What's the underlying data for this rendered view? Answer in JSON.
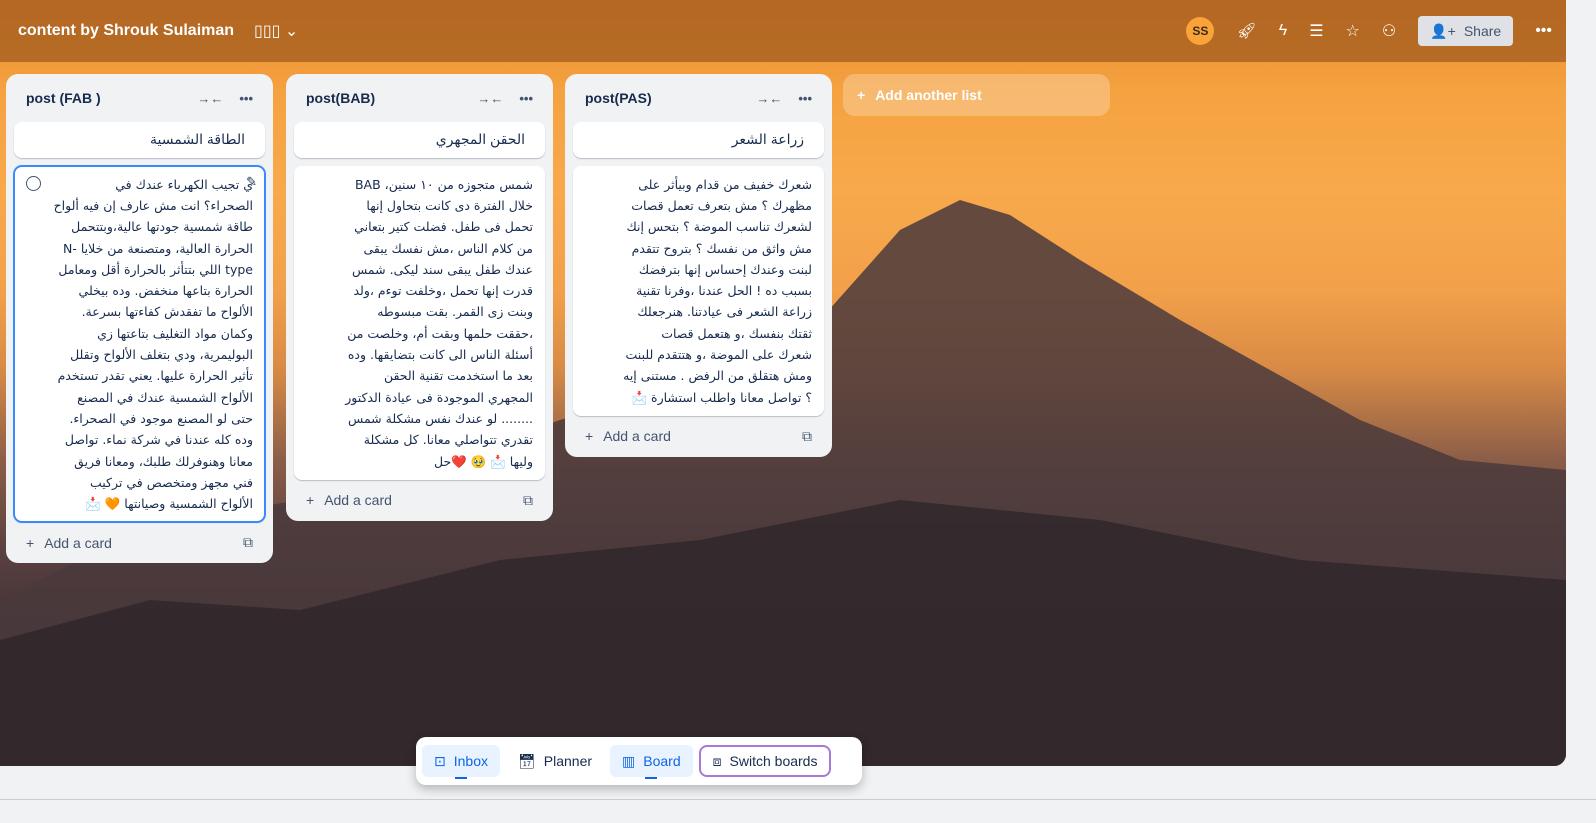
{
  "header": {
    "board_title": "content by Shrouk Sulaiman",
    "avatar_initials": "SS",
    "share_label": "Share"
  },
  "lists": [
    {
      "title": "post (FAB )",
      "cards": [
        {
          "title": "الطاقة الشمسية"
        },
        {
          "body": "ي تجيب الكهرباء عندك في\nالصحراء؟ انت مش عارف إن فيه ألواح\nطاقة شمسية جودتها عالية،وبتتحمل\nالحرارة العالية، ومتصنعة من خلايا -N\ntype اللي بتتأثر بالحرارة أقل ومعامل\nالحرارة بتاعها منخفض. وده بيخلي\nالألواح ما تفقدش كفاءتها بسرعة.\nوكمان مواد التغليف بتاعتها زي\nالبوليمرية، ودي بتغلف الألواح وتقلل\nتأثير الحرارة عليها. يعني تقدر تستخدم\nالألواح الشمسية عندك في المصنع\nحتى لو المصنع موجود في الصحراء.\nوده كله عندنا في شركة نماء. تواصل\nمعانا وهنوفرلك طلبك، ومعانا فريق\nفني مجهز ومتخصص في تركيب\nالألواح الشمسية وصيانتها 🧡 📩"
        }
      ],
      "add_card": "Add a card"
    },
    {
      "title": "post(BAB)",
      "cards": [
        {
          "title": "الحقن المجهري"
        },
        {
          "body": "شمس متجوزه من ١٠ سنين، BAB\nخلال الفترة دى كانت بتحاول إنها\nتحمل فى طفل. فضلت كتير بتعاني\nمن كلام الناس ،مش نفسك يبقى\nعندك طفل يبقى سند ليكى. شمس\nقدرت إنها تحمل ،وخلفت توءم ،ولد\nوبنت زى القمر. بقت مبسوطه\n،حققت حلمها وبقت أم، وخلصت من\nأسئلة الناس الى كانت بتضايقها. وده\nبعد ما استخدمت تقنية الحقن\nالمجهري الموجودة فى عيادة الدكتور\n........ لو عندك نفس مشكلة شمس\nتقدري تتواصلي معانا. كل مشكلة\nوليها 📩 🥹 ❤️حل"
        }
      ],
      "add_card": "Add a card"
    },
    {
      "title": "post(PAS)",
      "cards": [
        {
          "title": "زراعة الشعر"
        },
        {
          "body": "شعرك خفيف من قدام وبيأثر على\nمظهرك ؟ مش بتعرف تعمل قصات\nلشعرك تناسب الموضة ؟ بتحس إنك\nمش واثق من نفسك ؟ بتروح تتقدم\nلبنت وعندك إحساس إنها بترفضك\nبسبب ده ! الحل عندنا ،وفرنا تقنية\nزراعة الشعر فى عيادتنا. هنرجعلك\nثقتك بنفسك ،و هتعمل قصات\nشعرك على الموضة ،و هتتقدم للبنت\nومش هتقلق من الرفض . مستنى إيه\n؟ تواصل معانا واطلب استشارة 📩"
        }
      ],
      "add_card": "Add a card"
    }
  ],
  "add_list": "Add another list",
  "dock": {
    "inbox": "Inbox",
    "planner": "Planner",
    "board": "Board",
    "switch": "Switch boards"
  }
}
